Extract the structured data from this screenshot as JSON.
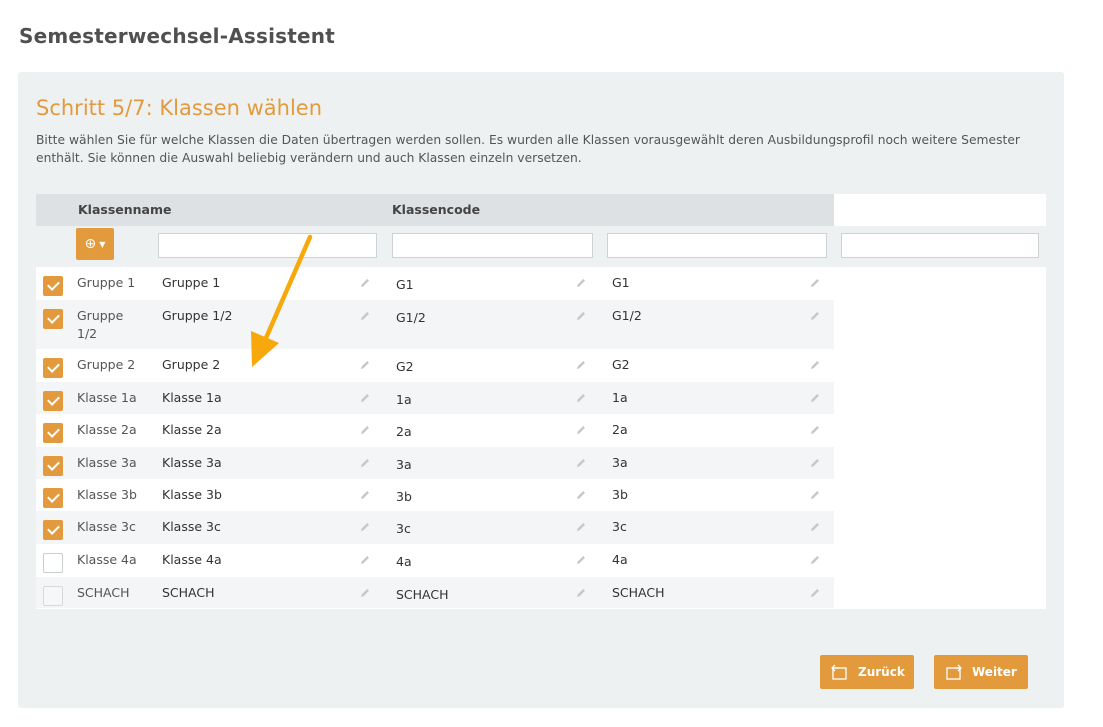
{
  "page_title": "Semesterwechsel-Assistent",
  "step": {
    "title": "Schritt 5/7: Klassen wählen",
    "description": "Bitte wählen Sie für welche Klassen die Daten übertragen werden sollen. Es wurden alle Klassen vorausgewählt deren Ausbildungsprofil noch weitere Semester enthält. Sie können die Auswahl beliebig verändern und auch Klassen einzeln versetzen."
  },
  "table": {
    "headers": {
      "name": "Klassenname",
      "code": "Klassencode"
    },
    "add_button_icon": "plus-circle-icon",
    "filters": {
      "name": "",
      "code1": "",
      "code2": "",
      "extra": ""
    },
    "rows": [
      {
        "label": "Gruppe 1",
        "name": "Gruppe 1",
        "code1": "G1",
        "code2": "G1",
        "checked": true
      },
      {
        "label": "Gruppe 1/2",
        "name": "Gruppe 1/2",
        "code1": "G1/2",
        "code2": "G1/2",
        "checked": true
      },
      {
        "label": "Gruppe 2",
        "name": "Gruppe 2",
        "code1": "G2",
        "code2": "G2",
        "checked": true
      },
      {
        "label": "Klasse 1a",
        "name": "Klasse 1a",
        "code1": "1a",
        "code2": "1a",
        "checked": true
      },
      {
        "label": "Klasse 2a",
        "name": "Klasse 2a",
        "code1": "2a",
        "code2": "2a",
        "checked": true
      },
      {
        "label": "Klasse 3a",
        "name": "Klasse 3a",
        "code1": "3a",
        "code2": "3a",
        "checked": true
      },
      {
        "label": "Klasse 3b",
        "name": "Klasse 3b",
        "code1": "3b",
        "code2": "3b",
        "checked": true
      },
      {
        "label": "Klasse 3c",
        "name": "Klasse 3c",
        "code1": "3c",
        "code2": "3c",
        "checked": true
      },
      {
        "label": "Klasse 4a",
        "name": "Klasse 4a",
        "code1": "4a",
        "code2": "4a",
        "checked": false
      },
      {
        "label": "SCHACH",
        "name": "SCHACH",
        "code1": "SCHACH",
        "code2": "SCHACH",
        "checked": false,
        "disabled": true
      }
    ]
  },
  "buttons": {
    "back": "Zurück",
    "next": "Weiter"
  },
  "colors": {
    "accent": "#e29a3c",
    "panel": "#eef1f2",
    "annotation_arrow": "#f7a90b"
  }
}
